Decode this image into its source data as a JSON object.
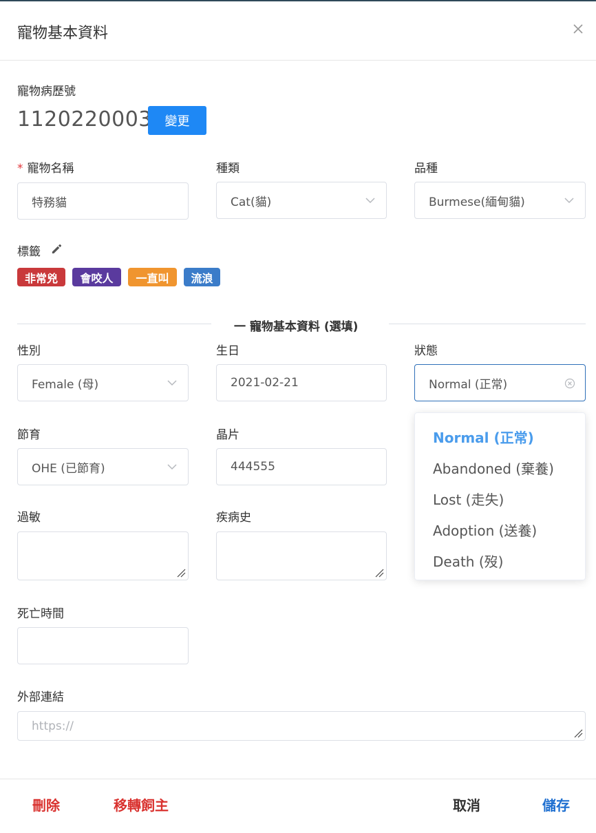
{
  "dialog": {
    "title": "寵物基本資料"
  },
  "record": {
    "label": "寵物病歷號",
    "number": "1120220003",
    "change_button": "變更"
  },
  "pet_name": {
    "required_mark": "*",
    "label": "寵物名稱",
    "value": "特務貓"
  },
  "species": {
    "label": "種類",
    "value": "Cat(貓)"
  },
  "breed": {
    "label": "品種",
    "value": "Burmese(緬甸貓)"
  },
  "tags": {
    "label": "標籤",
    "items": [
      {
        "text": "非常兇",
        "color": "#c9393b"
      },
      {
        "text": "會咬人",
        "color": "#5a3a9e"
      },
      {
        "text": "一直叫",
        "color": "#f0952f"
      },
      {
        "text": "流浪",
        "color": "#3b7cc9"
      }
    ]
  },
  "optional_section": {
    "title": "一  寵物基本資料 (選填)"
  },
  "gender": {
    "label": "性別",
    "value": "Female (母)"
  },
  "birthday": {
    "label": "生日",
    "value": "2021-02-21"
  },
  "status": {
    "label": "狀態",
    "value": "Normal (正常)",
    "options": [
      "Normal (正常)",
      "Abandoned (棄養)",
      "Lost (走失)",
      "Adoption (送養)",
      "Death (歿)"
    ],
    "selected_index": 0
  },
  "neutered": {
    "label": "節育",
    "value": "OHE (已節育)"
  },
  "chip": {
    "label": "晶片",
    "value": "444555"
  },
  "allergy": {
    "label": "過敏",
    "value": ""
  },
  "disease_history": {
    "label": "疾病史",
    "value": ""
  },
  "death_time": {
    "label": "死亡時間",
    "value": ""
  },
  "external_link": {
    "label": "外部連結",
    "placeholder": "https://"
  },
  "footer": {
    "delete": "刪除",
    "transfer": "移轉飼主",
    "cancel": "取消",
    "save": "儲存"
  },
  "colors": {
    "primary": "#1e88f5",
    "danger": "#d9322f",
    "selected_option": "#4a9cec",
    "focus_border": "#2e6fb8"
  }
}
